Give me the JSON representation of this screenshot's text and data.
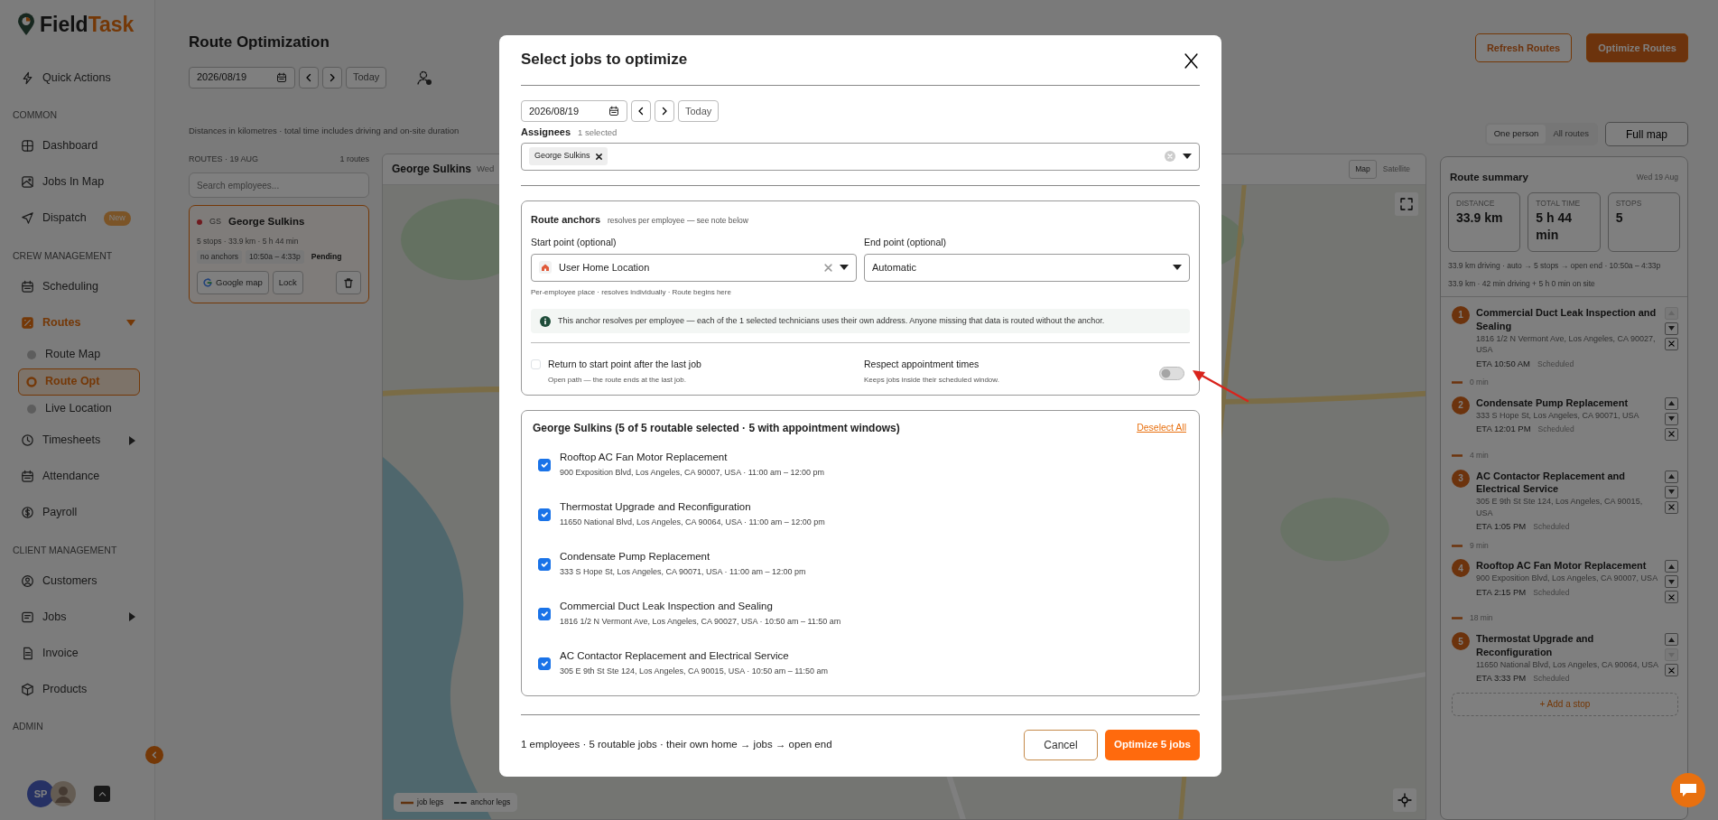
{
  "brand": {
    "first": "Field",
    "second": "Task"
  },
  "sidebar": {
    "sections": [
      {
        "items": [
          {
            "label": "Quick Actions",
            "selected": false
          }
        ]
      },
      {
        "heading": "COMMON",
        "items": [
          {
            "label": "Dashboard",
            "selected": false
          },
          {
            "label": "Jobs In Map",
            "selected": false
          },
          {
            "label": "Dispatch",
            "selected": false,
            "badge": "New"
          }
        ]
      },
      {
        "heading": "CREW MANAGEMENT",
        "items": [
          {
            "label": "Scheduling",
            "selected": false
          },
          {
            "label": "Routes",
            "selected": true,
            "expanded": true,
            "children": [
              {
                "label": "Route Map",
                "selected": false
              },
              {
                "label": "Route Opt",
                "selected": true
              },
              {
                "label": "Live Location",
                "selected": false
              }
            ]
          },
          {
            "label": "Timesheets",
            "selected": false,
            "expanded": false
          },
          {
            "label": "Attendance",
            "selected": false
          },
          {
            "label": "Payroll",
            "selected": false
          }
        ]
      },
      {
        "heading": "CLIENT MANAGEMENT",
        "items": [
          {
            "label": "Customers",
            "selected": false
          },
          {
            "label": "Jobs",
            "selected": false,
            "expanded": false
          },
          {
            "label": "Invoice",
            "selected": false
          },
          {
            "label": "Products",
            "selected": false
          }
        ]
      },
      {
        "heading": "ADMIN"
      }
    ],
    "user_initials": "SP"
  },
  "page": {
    "title": "Route Optimization",
    "date": "2026/08/19",
    "today_button": "Today",
    "note": "Distances in kilometres · total time includes driving and on-site duration",
    "actions": [
      "Refresh Routes",
      "Optimize Routes"
    ]
  },
  "routes": {
    "heading": "ROUTES · 19 AUG",
    "count": "1 routes",
    "search_placeholder": "Search employees...",
    "cards": [
      {
        "initials": "GS",
        "name": "George Sulkins",
        "stats": "5 stops · 33.9 km · 5 h 44 min",
        "tags": [
          "no anchors",
          "10:50a – 4:33p"
        ],
        "status": "Pending",
        "selected": true,
        "buttons": [
          "Google map",
          "Lock"
        ]
      }
    ]
  },
  "map": {
    "name": "George Sulkins",
    "date": "Wed",
    "types": [
      {
        "label": "Map",
        "selected": true
      },
      {
        "label": "Satellite",
        "selected": false
      }
    ],
    "legend": [
      {
        "label": "job legs",
        "kind": "solid"
      },
      {
        "label": "anchor legs",
        "kind": "dashed"
      }
    ]
  },
  "view": {
    "modes": [
      {
        "label": "One person",
        "selected": true
      },
      {
        "label": "All routes",
        "selected": false
      }
    ],
    "full_map": "Full map"
  },
  "summary": {
    "title": "Route summary",
    "date": "Wed 19 Aug",
    "stats": [
      {
        "label": "DISTANCE",
        "value": "33.9 km"
      },
      {
        "label": "TOTAL TIME",
        "value": "5 h 44 min"
      },
      {
        "label": "STOPS",
        "value": "5"
      }
    ],
    "lines": [
      "33.9 km driving · auto → 5 stops → open end · 10:50a – 4:33p",
      "33.9 km · 42 min driving + 5 h 0 min on site"
    ],
    "stops": [
      {
        "number": "1",
        "title": "Commercial Duct Leak Inspection and Sealing",
        "address": "1816 1/2 N Vermont Ave, Los Angeles, CA 90027, USA",
        "eta": "ETA 10:50 AM",
        "status": "Scheduled",
        "move_up_disabled": true,
        "move_down_disabled": false,
        "travel_after": "0 min"
      },
      {
        "number": "2",
        "title": "Condensate Pump Replacement",
        "address": "333 S Hope St, Los Angeles, CA 90071, USA",
        "eta": "ETA 12:01 PM",
        "status": "Scheduled",
        "move_up_disabled": false,
        "move_down_disabled": false,
        "travel_after": "4 min"
      },
      {
        "number": "3",
        "title": "AC Contactor Replacement and Electrical Service",
        "address": "305 E 9th St Ste 124, Los Angeles, CA 90015, USA",
        "eta": "ETA 1:05 PM",
        "status": "Scheduled",
        "move_up_disabled": false,
        "move_down_disabled": false,
        "travel_after": "9 min"
      },
      {
        "number": "4",
        "title": "Rooftop AC Fan Motor Replacement",
        "address": "900 Exposition Blvd, Los Angeles, CA 90007, USA",
        "eta": "ETA 2:15 PM",
        "status": "Scheduled",
        "move_up_disabled": false,
        "move_down_disabled": false,
        "travel_after": "18 min"
      },
      {
        "number": "5",
        "title": "Thermostat Upgrade and Reconfiguration",
        "address": "11650 National Blvd, Los Angeles, CA 90064, USA",
        "eta": "ETA 3:33 PM",
        "status": "Scheduled",
        "move_up_disabled": false,
        "move_down_disabled": true
      }
    ],
    "add_stop": "+ Add a stop"
  },
  "modal": {
    "title": "Select jobs to optimize",
    "date": "2026/08/19",
    "today_button": "Today",
    "assignees_label": "Assignees",
    "assignees_count": "1 selected",
    "assignees": [
      "George Sulkins"
    ],
    "anchors": {
      "title": "Route anchors",
      "subtitle": "resolves per employee — see note below",
      "start_label": "Start point (optional)",
      "start_value": "User Home Location",
      "end_label": "End point (optional)",
      "end_value": "Automatic",
      "start_hint": "Per-employee place · resolves individually · Route begins here",
      "info": "This anchor resolves per employee — each of the 1 selected technicians uses their own address. Anyone missing that data is routed without the anchor.",
      "return_trip": {
        "label": "Return to start point after the last job",
        "hint": "Open path — the route ends at the last job.",
        "checked": false
      },
      "respect_times": {
        "label": "Respect appointment times",
        "hint": "Keeps jobs inside their scheduled window.",
        "on": false
      }
    },
    "group": {
      "title": "George Sulkins (5 of 5 routable selected · 5 with appointment windows)",
      "deselect_all": "Deselect All",
      "jobs": [
        {
          "title": "Rooftop AC Fan Motor Replacement",
          "details": "900 Exposition Blvd, Los Angeles, CA 90007, USA · 11:00 am – 12:00 pm",
          "checked": true
        },
        {
          "title": "Thermostat Upgrade and Reconfiguration",
          "details": "11650 National Blvd, Los Angeles, CA 90064, USA · 11:00 am – 12:00 pm",
          "checked": true
        },
        {
          "title": "Condensate Pump Replacement",
          "details": "333 S Hope St, Los Angeles, CA 90071, USA · 11:00 am – 12:00 pm",
          "checked": true
        },
        {
          "title": "Commercial Duct Leak Inspection and Sealing",
          "details": "1816 1/2 N Vermont Ave, Los Angeles, CA 90027, USA · 10:50 am – 11:50 am",
          "checked": true
        },
        {
          "title": "AC Contactor Replacement and Electrical Service",
          "details": "305 E 9th St Ste 124, Los Angeles, CA 90015, USA · 10:50 am – 11:50 am",
          "checked": true
        }
      ]
    },
    "footer_summary": "1 employees · 5 routable jobs · their own home → jobs → open end",
    "buttons": [
      "Cancel",
      "Optimize 5 jobs"
    ]
  }
}
